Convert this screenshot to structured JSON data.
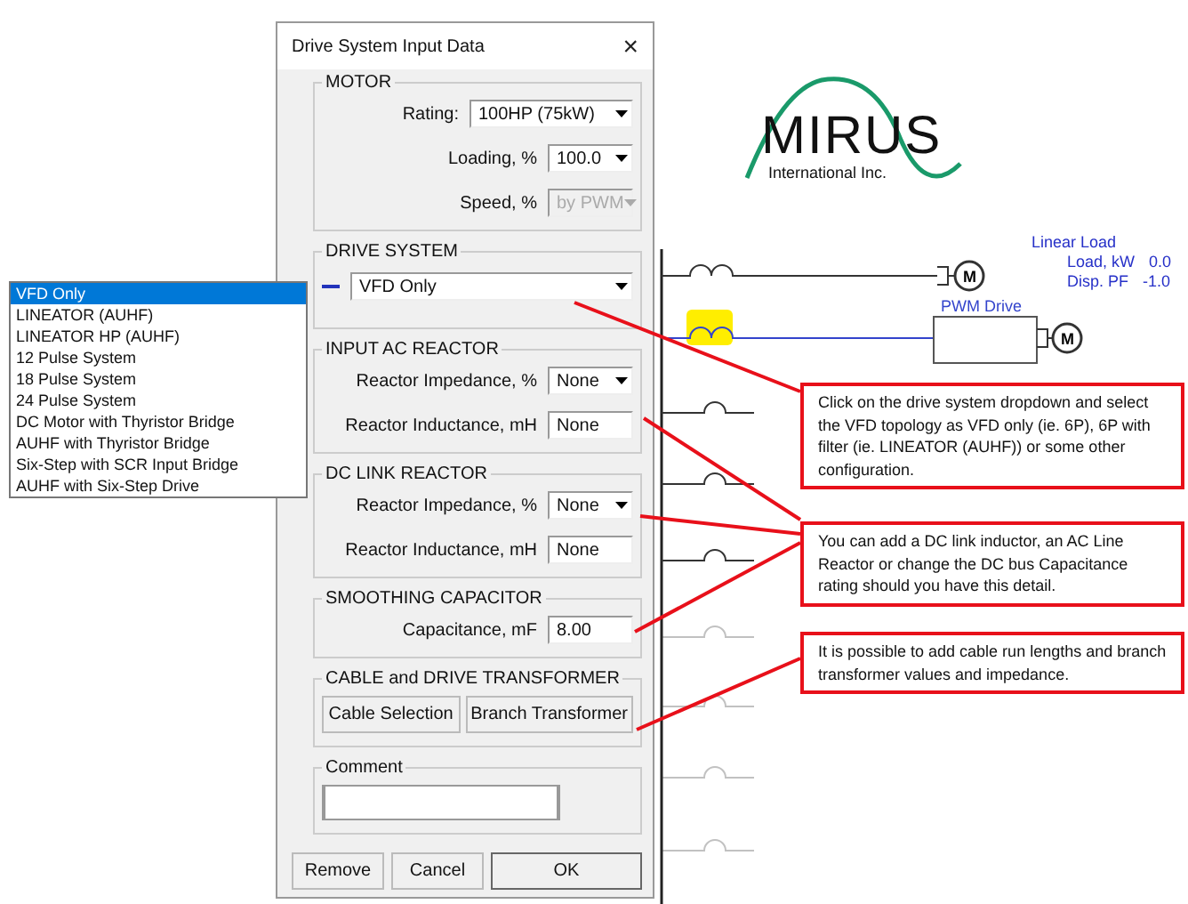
{
  "diagram": {
    "logo": {
      "name": "MIRUS",
      "subtitle": "International Inc."
    },
    "load": {
      "title": "Linear Load",
      "rows": [
        {
          "label": "Load, kW",
          "value": "0.0"
        },
        {
          "label": "Disp. PF",
          "value": "-1.0"
        }
      ]
    },
    "branches": [
      {
        "kind": "motor",
        "highlighted": false,
        "faded": false,
        "motor": "M"
      },
      {
        "kind": "drive",
        "highlighted": true,
        "faded": false,
        "motor": "M",
        "drive_label": "PWM Drive"
      },
      {
        "kind": "stub",
        "highlighted": false,
        "faded": false
      },
      {
        "kind": "stub",
        "highlighted": false,
        "faded": false
      },
      {
        "kind": "stub",
        "highlighted": false,
        "faded": false
      },
      {
        "kind": "stub",
        "highlighted": false,
        "faded": true
      },
      {
        "kind": "stub",
        "highlighted": false,
        "faded": true
      },
      {
        "kind": "stub",
        "highlighted": false,
        "faded": true
      },
      {
        "kind": "stub",
        "highlighted": false,
        "faded": true
      }
    ]
  },
  "dialog": {
    "title": "Drive System Input Data",
    "close": "×",
    "groups": [
      {
        "legend": "MOTOR",
        "rows": [
          {
            "kind": "select",
            "label": "Rating:",
            "value": "100HP (75kW)",
            "disabled": false,
            "wide": true
          },
          {
            "kind": "select",
            "label": "Loading, %",
            "value": "100.0",
            "disabled": false,
            "wide": false
          },
          {
            "kind": "select",
            "label": "Speed, %",
            "value": "by PWM",
            "disabled": true,
            "wide": false
          }
        ]
      },
      {
        "legend": "DRIVE SYSTEM",
        "rows": [
          {
            "kind": "drive",
            "value": "VFD Only"
          }
        ]
      },
      {
        "legend": "INPUT AC REACTOR",
        "rows": [
          {
            "kind": "select",
            "label": "Reactor Impedance, %",
            "value": "None",
            "disabled": false,
            "wide": false
          },
          {
            "kind": "input",
            "label": "Reactor Inductance, mH",
            "value": "None"
          }
        ]
      },
      {
        "legend": "DC LINK REACTOR",
        "rows": [
          {
            "kind": "select",
            "label": "Reactor Impedance, %",
            "value": "None",
            "disabled": false,
            "wide": false
          },
          {
            "kind": "input",
            "label": "Reactor Inductance, mH",
            "value": "None"
          }
        ]
      },
      {
        "legend": "SMOOTHING CAPACITOR",
        "rows": [
          {
            "kind": "input",
            "label": "Capacitance, mF",
            "value": "8.00"
          }
        ]
      },
      {
        "legend": "CABLE and DRIVE TRANSFORMER",
        "rows": [
          {
            "kind": "buttons",
            "buttons": [
              "Cable Selection",
              "Branch Transformer"
            ]
          }
        ]
      },
      {
        "legend": "Comment",
        "rows": [
          {
            "kind": "comment"
          }
        ]
      }
    ],
    "buttons": [
      "Remove",
      "Cancel",
      "OK"
    ]
  },
  "dropdown": {
    "items": [
      {
        "label": "VFD Only",
        "selected": true
      },
      {
        "label": "LINEATOR (AUHF)",
        "selected": false
      },
      {
        "label": "LINEATOR HP (AUHF)",
        "selected": false
      },
      {
        "label": "12 Pulse System",
        "selected": false
      },
      {
        "label": "18 Pulse System",
        "selected": false
      },
      {
        "label": "24 Pulse System",
        "selected": false
      },
      {
        "label": "DC Motor with Thyristor Bridge",
        "selected": false
      },
      {
        "label": "AUHF with Thyristor Bridge",
        "selected": false
      },
      {
        "label": "Six-Step with SCR Input Bridge",
        "selected": false
      },
      {
        "label": "AUHF with Six-Step Drive",
        "selected": false
      }
    ]
  },
  "callouts": [
    {
      "text": "Click on the drive system dropdown and select the VFD topology as VFD only (ie. 6P), 6P with filter (ie. LINEATOR (AUHF)) or some other configuration."
    },
    {
      "text": "You can add a DC link inductor, an AC Line Reactor or change the DC bus Capacitance rating should you have this detail."
    },
    {
      "text": "It is possible to add cable run lengths and branch transformer values and impedance."
    }
  ]
}
